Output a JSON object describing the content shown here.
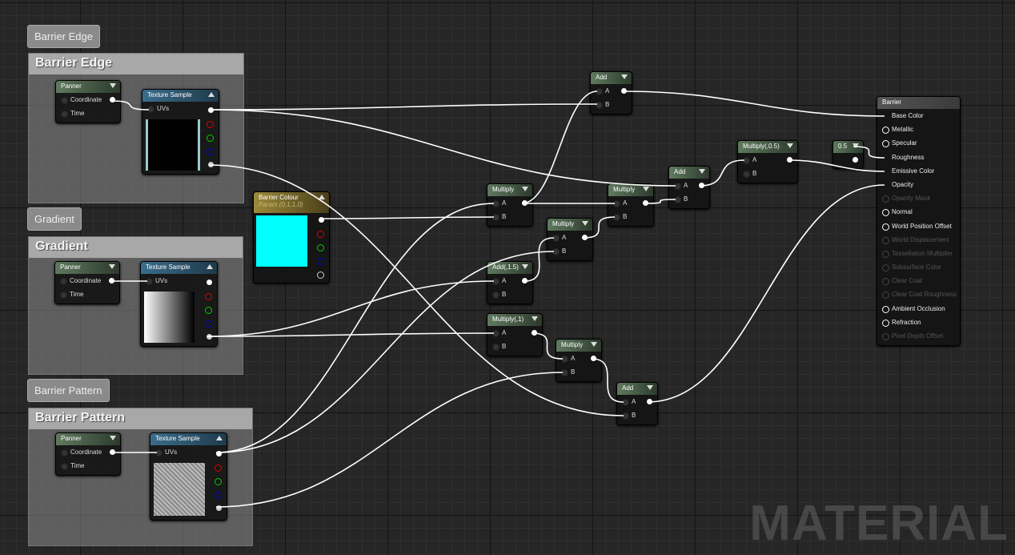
{
  "comments": [
    {
      "label": "Barrier Edge",
      "title": "Barrier Edge"
    },
    {
      "label": "Gradient",
      "title": "Gradient"
    },
    {
      "label": "Barrier Pattern",
      "title": "Barrier Pattern"
    }
  ],
  "panner": {
    "title": "Panner",
    "coordinate": "Coordinate",
    "time": "Time"
  },
  "texture": {
    "title": "Texture Sample",
    "uvs": "UVs"
  },
  "param": {
    "title": "Barrier Colour",
    "subtitle": "Param (0,1,1,0)",
    "color": "#00ffff"
  },
  "nodes": {
    "add": "Add",
    "multiply": "Multiply",
    "mul05": "Multiply(,0.5)",
    "add15": "Add(,1.5)",
    "mul1": "Multiply(,1)",
    "const": "0.5",
    "a": "A",
    "b": "B"
  },
  "material": {
    "title": "Barrier",
    "inputs": [
      {
        "label": "Base Color",
        "state": "connected"
      },
      {
        "label": "Metallic",
        "state": "open"
      },
      {
        "label": "Specular",
        "state": "open"
      },
      {
        "label": "Roughness",
        "state": "connected"
      },
      {
        "label": "Emissive Color",
        "state": "connected"
      },
      {
        "label": "Opacity",
        "state": "connected"
      },
      {
        "label": "Opacity Mask",
        "state": "disabled"
      },
      {
        "label": "Normal",
        "state": "open"
      },
      {
        "label": "World Position Offset",
        "state": "open"
      },
      {
        "label": "World Displacement",
        "state": "disabled"
      },
      {
        "label": "Tessellation Multiplier",
        "state": "disabled"
      },
      {
        "label": "Subsurface Color",
        "state": "disabled"
      },
      {
        "label": "Clear Coat",
        "state": "disabled"
      },
      {
        "label": "Clear Coat Roughness",
        "state": "disabled"
      },
      {
        "label": "Ambient Occlusion",
        "state": "open"
      },
      {
        "label": "Refraction",
        "state": "open"
      },
      {
        "label": "Pixel Depth Offset",
        "state": "disabled"
      }
    ]
  },
  "watermark": "MATERIAL"
}
